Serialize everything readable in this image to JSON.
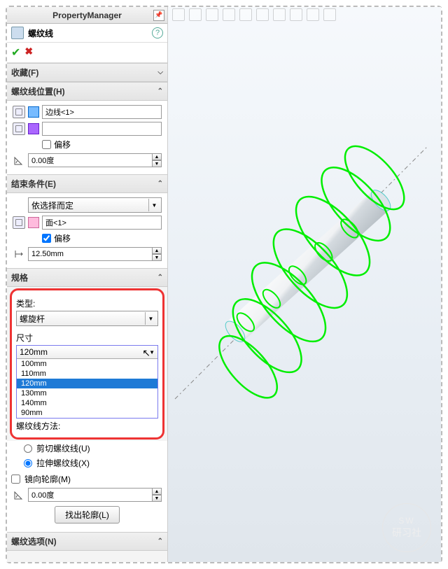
{
  "header": {
    "title": "PropertyManager"
  },
  "feature": {
    "name": "螺纹线"
  },
  "sections": {
    "favorites": {
      "title": "收藏(F)"
    },
    "location": {
      "title": "螺纹线位置(H)",
      "edge_sel": "边线<1>",
      "offset_label": "偏移",
      "angle": "0.00度"
    },
    "end": {
      "title": "结束条件(E)",
      "method": "依选择而定",
      "face_sel": "面<1>",
      "offset_label": "偏移",
      "offset_value": "12.50mm"
    },
    "spec": {
      "title": "规格",
      "type_label": "类型:",
      "type_value": "螺旋杆",
      "size_label": "尺寸",
      "size_selected": "120mm",
      "size_options": [
        "100mm",
        "110mm",
        "120mm",
        "130mm",
        "140mm",
        "90mm"
      ],
      "method_partial": "螺纹线方法:",
      "radio_cut": "剪切螺纹线(U)",
      "radio_extrude": "拉伸螺纹线(X)",
      "mirror": "镜向轮廓(M)",
      "angle2": "0.00度",
      "find_profile": "找出轮廓(L)"
    },
    "options": {
      "title": "螺纹选项(N)"
    }
  },
  "watermark": {
    "l1": "SW",
    "l2": "研习社"
  }
}
